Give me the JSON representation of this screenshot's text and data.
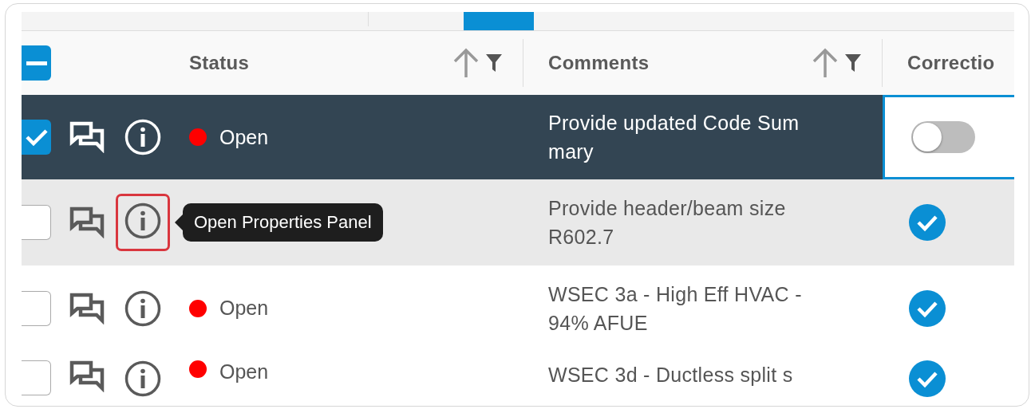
{
  "table": {
    "select_all": {
      "indeterminate": true
    },
    "columns": [
      {
        "label": "Status",
        "sortable": true,
        "filterable": true
      },
      {
        "label": "Comments",
        "sortable": true,
        "filterable": true
      },
      {
        "label": "Correctio"
      }
    ],
    "rows": [
      {
        "selected": true,
        "hovered": false,
        "info_highlighted": false,
        "status": "Open",
        "comment": [
          "Provide updated Code Sum",
          "mary"
        ],
        "correction": {
          "kind": "toggle",
          "on": false,
          "focused": true
        }
      },
      {
        "selected": false,
        "hovered": true,
        "info_highlighted": true,
        "tooltip": "Open Properties Panel",
        "comment": [
          "Provide header/beam size",
          "R602.7"
        ],
        "correction": {
          "kind": "check"
        }
      },
      {
        "selected": false,
        "hovered": false,
        "info_highlighted": false,
        "status": "Open",
        "comment": [
          "WSEC 3a - High Eff HVAC -",
          "94% AFUE"
        ],
        "correction": {
          "kind": "check"
        }
      },
      {
        "selected": false,
        "hovered": false,
        "info_highlighted": false,
        "status": "Open",
        "comment": [
          "WSEC 3d - Ductless split s"
        ],
        "correction": {
          "kind": "check"
        }
      }
    ]
  }
}
